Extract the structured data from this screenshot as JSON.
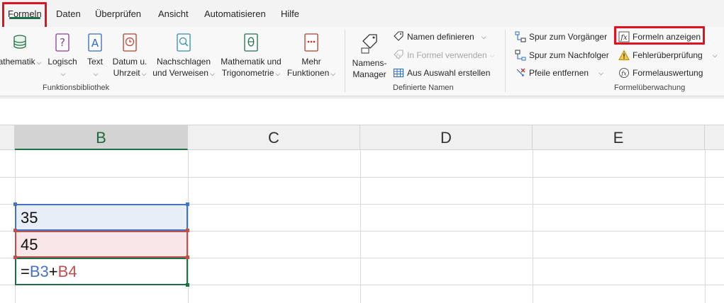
{
  "tabs": [
    {
      "label": "Formeln",
      "active": true
    },
    {
      "label": "Daten"
    },
    {
      "label": "Überprüfen"
    },
    {
      "label": "Ansicht"
    },
    {
      "label": "Automatisieren"
    },
    {
      "label": "Hilfe"
    }
  ],
  "ribbon": {
    "library": {
      "math_partial": "athematik",
      "logical": "Logisch",
      "text": "Text",
      "datetime_1": "Datum u.",
      "datetime_2": "Uhrzeit",
      "lookup_1": "Nachschlagen",
      "lookup_2": "und Verweisen",
      "mathtrig_1": "Mathematik und",
      "mathtrig_2": "Trigonometrie",
      "more_1": "Mehr",
      "more_2": "Funktionen",
      "group_label": "Funktionsbibliothek"
    },
    "names": {
      "manager_1": "Namens-",
      "manager_2": "Manager",
      "define": "Namen definieren",
      "use_in_formula": "In Formel verwenden",
      "create_from_selection": "Aus Auswahl erstellen",
      "group_label": "Definierte Namen"
    },
    "audit": {
      "trace_precedents": "Spur zum Vorgänger",
      "trace_dependents": "Spur zum Nachfolger",
      "remove_arrows": "Pfeile entfernen",
      "show_formulas": "Formeln anzeigen",
      "error_checking": "Fehlerüberprüfung",
      "evaluate_formula": "Formelauswertung",
      "group_label": "Formelüberwachung"
    }
  },
  "sheet": {
    "columns": [
      "B",
      "C",
      "D",
      "E"
    ],
    "selected_column": "B",
    "cells": {
      "b3": "35",
      "b4": "45",
      "b5_eq": "=",
      "b5_ref1": "B3",
      "b5_plus": "+",
      "b5_ref2": "B4"
    }
  },
  "colors": {
    "accent_green": "#1e7145",
    "highlight_red": "#e3101f",
    "ref_blue": "#4472c4",
    "ref_red": "#c0504d"
  }
}
